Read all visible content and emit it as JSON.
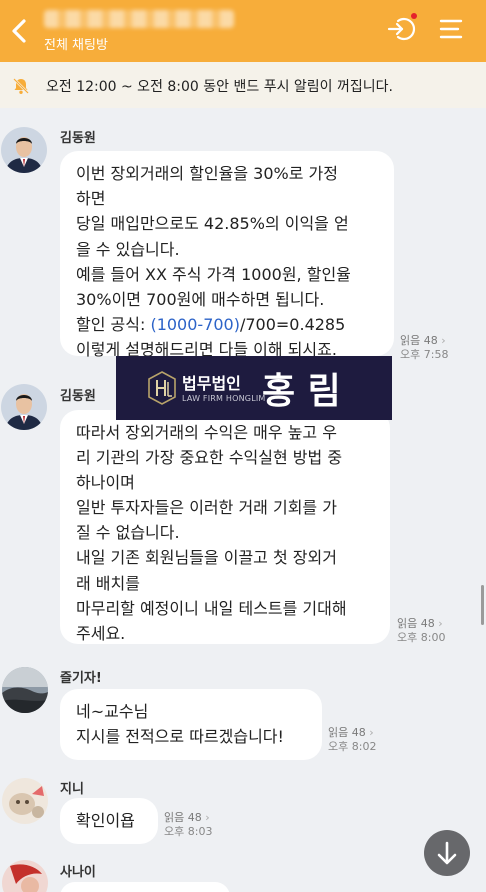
{
  "header": {
    "subtitle": "전체 채팅방",
    "accent": "#f7ad3a"
  },
  "banner": {
    "text": "오전 12:00 ~ 오전 8:00 동안 밴드 푸시 알림이 꺼집니다."
  },
  "watermark": {
    "kr": "법무법인",
    "en": "LAW FIRM HONGLIM",
    "big": "홍 림"
  },
  "messages": [
    {
      "name": "김동원",
      "lines": [
        "이번 장외거래의 할인율을 30%로 가정",
        "하면",
        "당일 매입만으로도 42.85%의 이익을 얻",
        "을 수 있습니다.",
        "예를 들어 XX 주식 가격 1000원, 할인율",
        "30%이면 700원에 매수하면 됩니다.",
        "할인 공식: ",
        "(1000-700)",
        "/700=0.4285",
        "이렇게 설명해드리면 다들 이해 되시죠."
      ],
      "read": "읽음 48",
      "time": "오후 7:58"
    },
    {
      "name": "김동원",
      "lines": [
        "따라서 장외거래의 수익은 매우 높고 우",
        "리 기관의 가장 중요한 수익실현 방법 중",
        "하나이며",
        "일반 투자자들은 이러한 거래 기회를 가",
        "질 수 없습니다.",
        "내일 기존 회원님들을 이끌고 첫 장외거",
        "래 배치를",
        "마무리할 예정이니 내일 테스트를 기대해",
        "주세요."
      ],
      "read": "읽음 48",
      "time": "오후 8:00"
    },
    {
      "name": "즐기자!",
      "lines": [
        "네~교수님",
        "지시를 전적으로 따르겠습니다!"
      ],
      "read": "읽음 48",
      "time": "오후 8:02"
    },
    {
      "name": "지니",
      "lines": [
        "확인이욥"
      ],
      "read": "읽음 48",
      "time": "오후 8:03"
    },
    {
      "name": "사나이",
      "lines": [],
      "read": "",
      "time": ""
    }
  ],
  "colors": {
    "link": "#2c63c8",
    "read_arrow": "#aaaaaa"
  }
}
